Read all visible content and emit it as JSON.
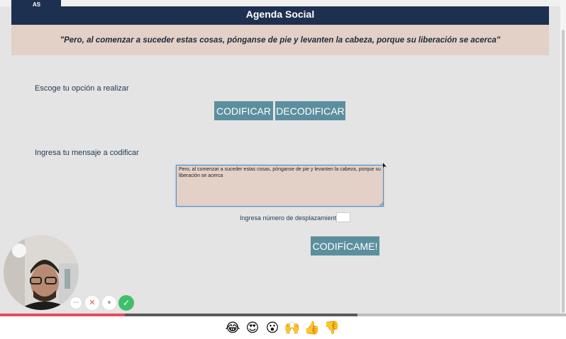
{
  "header": {
    "logo_text": "AS",
    "title": "Agenda Social",
    "quote": "\"Pero, al comenzar a suceder estas cosas, pónganse de pie y levanten la cabeza, porque su liberación se acerca\""
  },
  "main": {
    "option_label": "Escoge tu opción a realizar",
    "encode_button": "CODIFICAR",
    "decode_button": "DECODIFICAR",
    "message_label": "Ingresa tu mensaje a codificar",
    "message_value": "Pero, al comenzar a suceder estas cosas, pónganse de pie y levanten la cabeza, porque su liberación se acerca",
    "shift_label": "Ingresa número de desplazamiento",
    "shift_value": "",
    "submit_button": "CODIFÍCAME!"
  },
  "recorder": {
    "webcam": "webcam-feed",
    "controls": {
      "more": "⋯",
      "discard": "✕",
      "pause": "⏸",
      "finish": "✓"
    },
    "progress": 0.22,
    "colors": {
      "progress": "#e2505a",
      "finish": "#3fbf6a"
    }
  },
  "reactions": [
    "😂",
    "😍",
    "😮",
    "🙌",
    "👍",
    "👎"
  ]
}
